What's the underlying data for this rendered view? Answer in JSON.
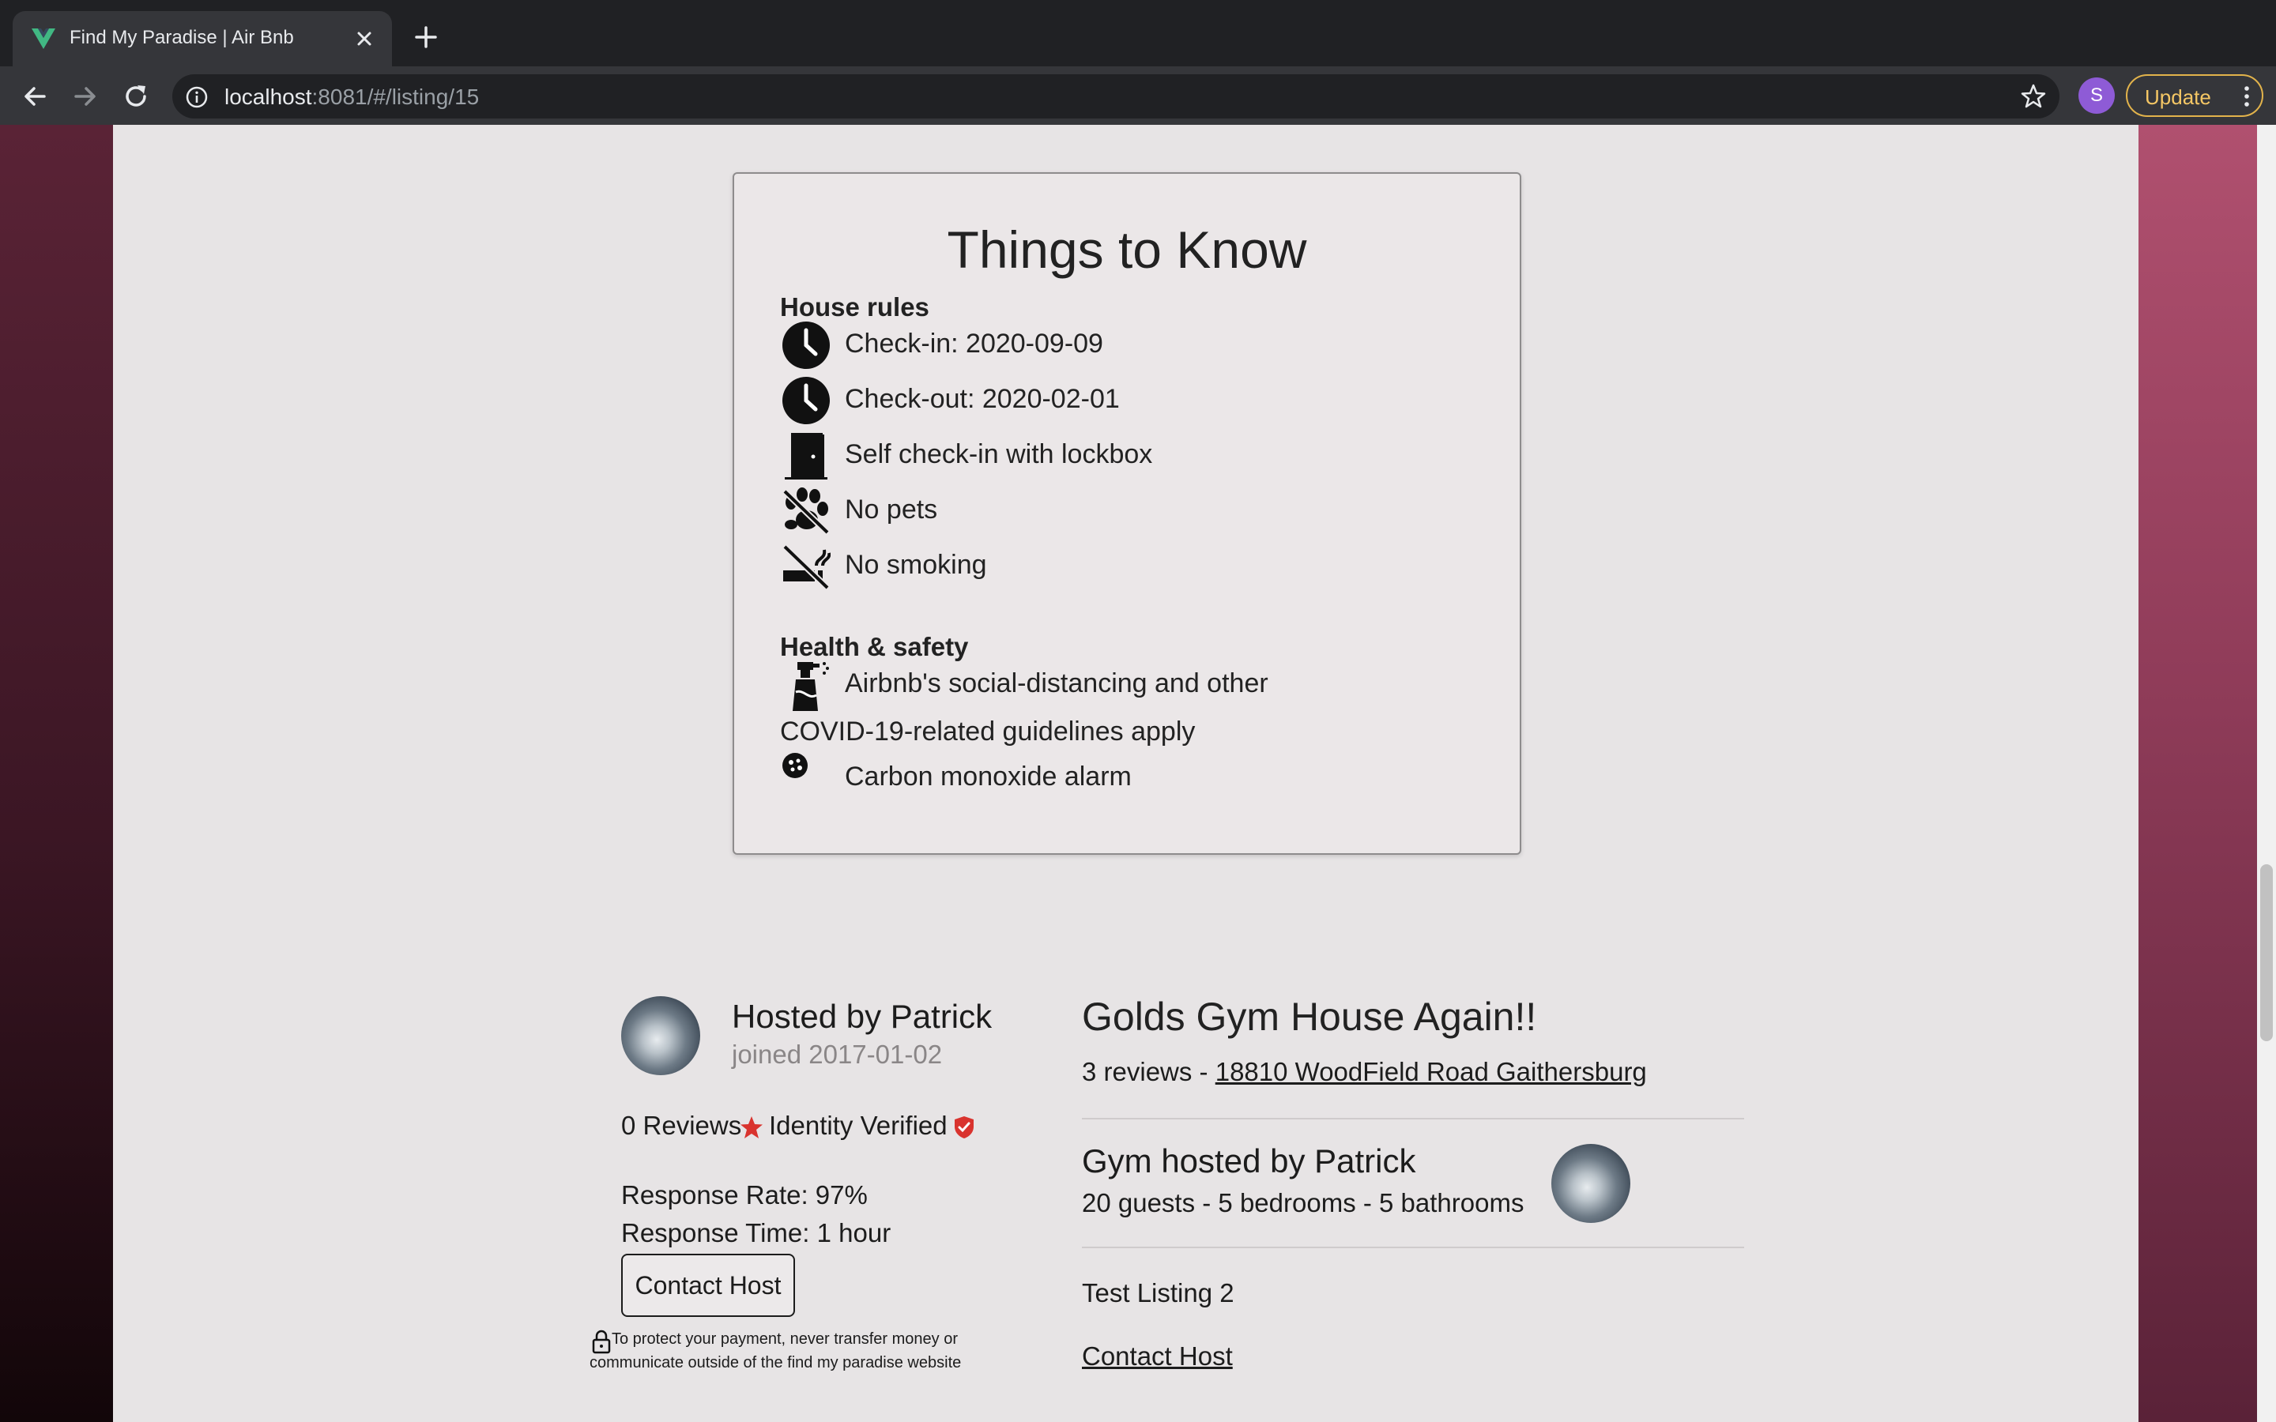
{
  "browser": {
    "tab_title": "Find My Paradise | Air Bnb",
    "url_host": "localhost",
    "url_rest": ":8081/#/listing/15",
    "profile_initial": "S",
    "update_label": "Update",
    "accent_update": "#e2b34b"
  },
  "things_to_know": {
    "title": "Things to Know",
    "house_rules_title": "House rules",
    "house_rules": [
      {
        "icon": "clock-icon",
        "text": "Check-in: 2020-09-09"
      },
      {
        "icon": "clock-icon",
        "text": "Check-out: 2020-02-01"
      },
      {
        "icon": "door-icon",
        "text": "Self check-in with lockbox"
      },
      {
        "icon": "no-pets-icon",
        "text": "No pets"
      },
      {
        "icon": "no-smoking-icon",
        "text": "No smoking"
      }
    ],
    "health_title": "Health & safety",
    "health": [
      {
        "icon": "spray-bottle-icon",
        "text": "Airbnb's social-distancing and other",
        "text2": "COVID-19-related guidelines apply"
      },
      {
        "icon": "alarm-icon",
        "text": "Carbon monoxide alarm"
      }
    ]
  },
  "host": {
    "hosted_by": "Hosted by Patrick",
    "joined": "joined 2017-01-02",
    "reviews": "0 Reviews",
    "identity": "Identity Verified",
    "response_rate": "Response Rate: 97%",
    "response_time": "Response Time: 1 hour",
    "contact_label": "Contact Host",
    "payment_note_line1": "To protect your payment, never transfer money or",
    "payment_note_line2": "communicate outside of the find my paradise website"
  },
  "listing": {
    "title": "Golds Gym House Again!!",
    "reviews": "3 reviews - ",
    "address": "18810 WoodField Road Gaithersburg",
    "subtitle": "Gym hosted by Patrick",
    "details": "20 guests - 5 bedrooms - 5 bathrooms",
    "description": "Test Listing 2",
    "contact_link": "Contact Host"
  },
  "colors": {
    "star": "#d9332e",
    "verified": "#d9332e",
    "content_bg": "#e7e4e5"
  }
}
